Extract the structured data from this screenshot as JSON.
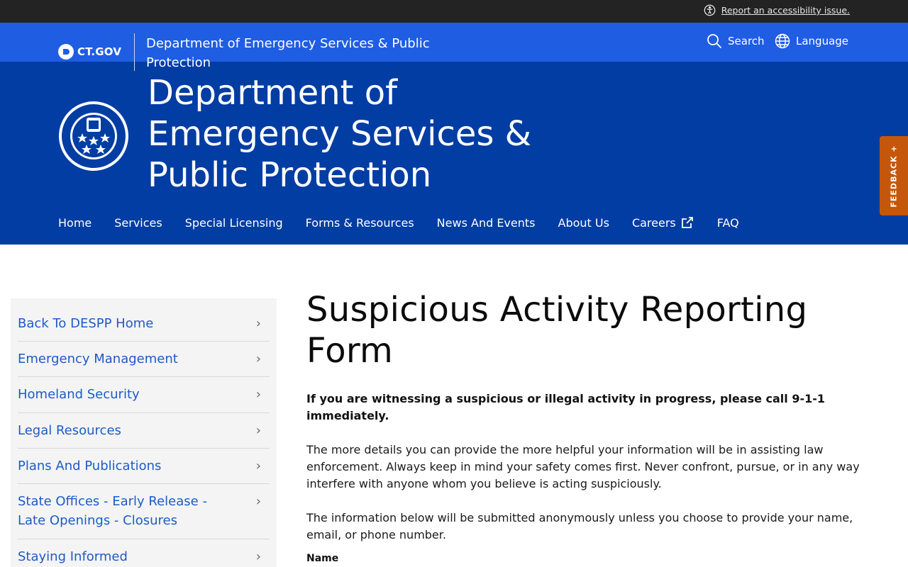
{
  "topbar": {
    "accessibility_link": "Report an accessibility issue.",
    "accessibility_icon": "accessibility-icon"
  },
  "ctbar": {
    "logo_text": "CT.GOV",
    "agency_name": "Department of Emergency Services & Public Protection",
    "search_label": "Search",
    "language_label": "Language"
  },
  "header": {
    "agency_title": "Department of Emergency Services & Public Protection",
    "seal_icon": "state-seal-icon"
  },
  "nav": {
    "items": [
      "Home",
      "Services",
      "Special Licensing",
      "Forms & Resources",
      "News And Events",
      "About Us",
      "Careers",
      "FAQ"
    ]
  },
  "feedback": {
    "label": "FEEDBACK +"
  },
  "sidebar": {
    "items": [
      {
        "label": "Back To DESPP Home"
      },
      {
        "label": "Emergency Management"
      },
      {
        "label": "Homeland Security"
      },
      {
        "label": "Legal Resources"
      },
      {
        "label": "Plans And Publications"
      },
      {
        "label": "State Offices - Early Release - Late Openings - Closures"
      },
      {
        "label": "Staying Informed"
      }
    ]
  },
  "main": {
    "title": "Suspicious Activity Reporting Form",
    "warning": "If you are witnessing a suspicious or illegal activity in progress, please call 9-1-1 immediately.",
    "paragraph1": "The more details you can provide the more helpful your information will be in assisting law enforcement. Always keep in mind your safety comes first. Never confront, pursue, or in any way interfere with anyone whom you believe is acting suspiciously.",
    "paragraph2": "The information below will be submitted anonymously unless you choose to provide your name, email, or phone number.",
    "name_label": "Name"
  },
  "colors": {
    "topbar": "#232323",
    "ctbar": "#1f5de3",
    "header": "#013da3",
    "feedback": "#c4570c",
    "link": "#1d5bc6"
  }
}
